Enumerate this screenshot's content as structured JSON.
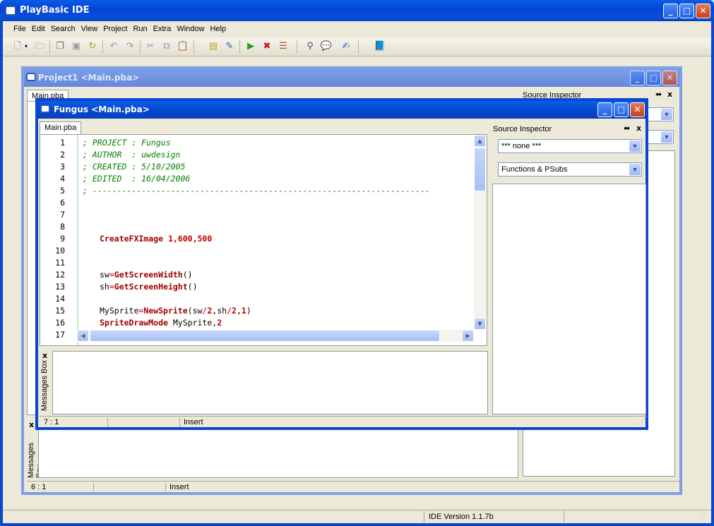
{
  "app": {
    "title": "PlayBasic IDE"
  },
  "menu": [
    "File",
    "Edit",
    "Search",
    "View",
    "Project",
    "Run",
    "Extra",
    "Window",
    "Help"
  ],
  "toolbar": {
    "icons": [
      "new-file-icon",
      "dropdown-icon",
      "open-icon",
      "save-all-icon",
      "save-icon",
      "reload-icon",
      "undo-icon",
      "redo-icon",
      "cut-icon",
      "copy-icon",
      "paste-icon",
      "project-icon",
      "compile-icon",
      "run-icon",
      "stop-debug-icon",
      "breakpoints-icon",
      "find-icon",
      "comment-icon",
      "edit-icon",
      "help-book-icon"
    ]
  },
  "project_window": {
    "title": "Project1 <Main.pba>",
    "tab": "Main.pba",
    "inspector_title": "Source Inspector",
    "messages_label": "Messages Box",
    "status": {
      "position": "6 :  1",
      "mode": "Insert"
    }
  },
  "fungus_window": {
    "title": "Fungus <Main.pba>",
    "tab": "Main.pba",
    "inspector_title": "Source Inspector",
    "inspector_dropdown1": "*** none ***",
    "inspector_dropdown2": "Functions & PSubs",
    "messages_label": "Messages Box",
    "status": {
      "position": "7 :  1",
      "mode": "Insert"
    },
    "line_numbers": [
      "1",
      "2",
      "3",
      "4",
      "5",
      "6",
      "7",
      "8",
      "9",
      "10",
      "11",
      "12",
      "13",
      "14",
      "15",
      "16",
      "17"
    ],
    "code": {
      "l1": "; PROJECT : Fungus",
      "l2": "; AUTHOR  : uwdesign",
      "l3": "; CREATED : 5/10/2005",
      "l4": "; EDITED  : 16/04/2006",
      "l5": "; ---------------------------------------------------------------------",
      "l9_kw": "CreateFXImage",
      "l9_args": "1,600,500",
      "l12_var": "sw",
      "l12_eq": "=",
      "l12_fn": "GetScreenWidth",
      "l12_paren": "()",
      "l13_var": "sh",
      "l13_eq": "=",
      "l13_fn": "GetScreenHeight",
      "l13_paren": "()",
      "l15_var": "MySprite",
      "l15_eq": "=",
      "l15_fn": "NewSprite",
      "l15_a": "(sw",
      "l15_b": "/",
      "l15_c": "2",
      "l15_d": ",sh",
      "l15_e": "/",
      "l15_f": "2",
      "l15_g": ",",
      "l15_h": "1",
      "l15_i": ")",
      "l16_kw": "SpriteDrawMode",
      "l16_a": " MySprite,",
      "l16_b": "2"
    }
  },
  "statusbar": {
    "version": "IDE Version 1.1.7b"
  },
  "colors": {
    "titlebar": "#0a4fd8",
    "comment": "#008000",
    "keyword": "#a00000",
    "number": "#c00000"
  }
}
